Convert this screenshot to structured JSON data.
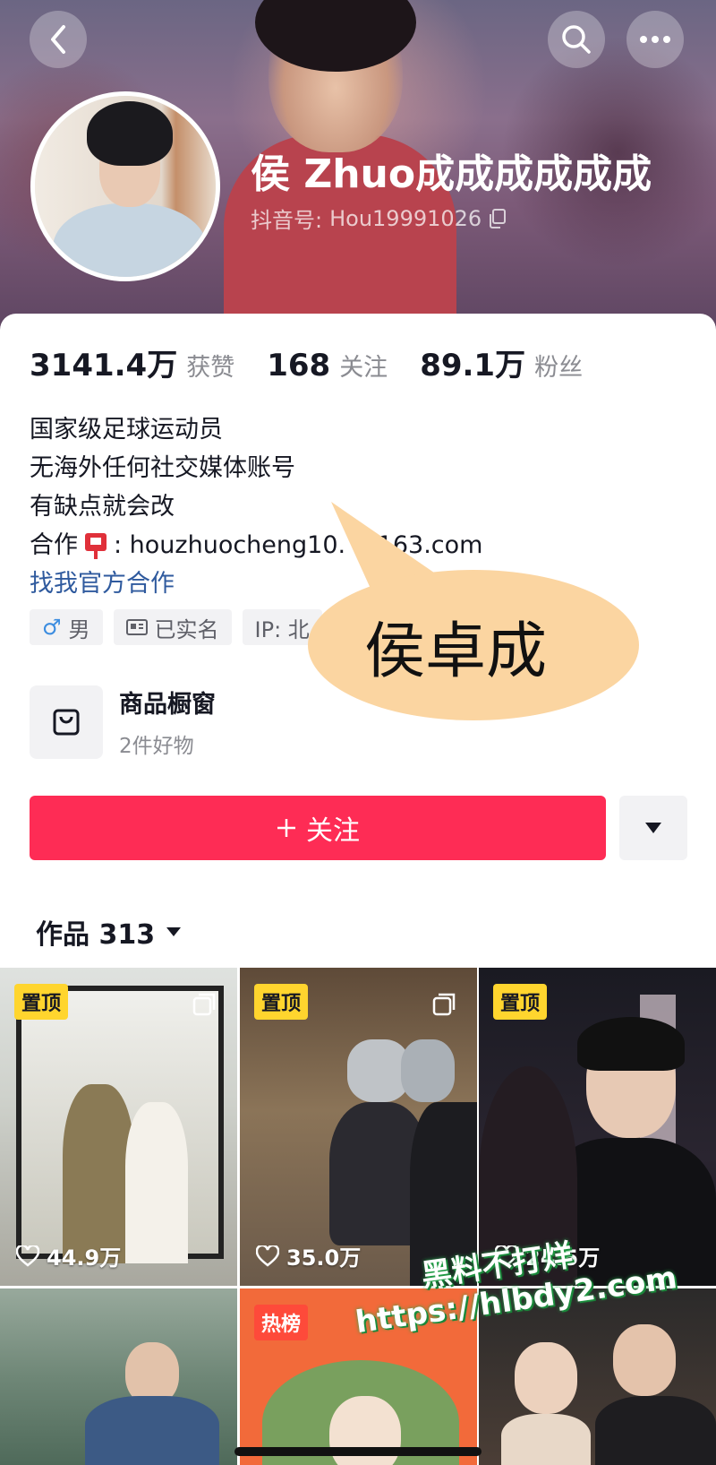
{
  "profile": {
    "name": "侯 Zhuo成成成成成成",
    "douyin_id_label": "抖音号:",
    "douyin_id": "Hou19991026"
  },
  "stats": [
    {
      "value": "3141.4万",
      "label": "获赞"
    },
    {
      "value": "168",
      "label": "关注"
    },
    {
      "value": "89.1万",
      "label": "粉丝"
    }
  ],
  "bio": {
    "line1": "国家级足球运动员",
    "line2": "无海外任何社交媒体账号",
    "line3": "有缺点就会改",
    "coop_label": "合作",
    "coop_email": ": houzhuocheng10.  @163.com",
    "official_link": "找我官方合作"
  },
  "tags": {
    "gender": "男",
    "verified": "已实名",
    "ip": "IP: 北"
  },
  "shop": {
    "title": "商品橱窗",
    "subtitle": "2件好物"
  },
  "actions": {
    "follow_label": "关注"
  },
  "works": {
    "label": "作品 313"
  },
  "annotation": {
    "bubble_text": "侯卓成"
  },
  "videos": [
    {
      "badge": "置顶",
      "likes": "44.9万"
    },
    {
      "badge": "置顶",
      "likes": "35.0万"
    },
    {
      "badge": "置顶",
      "likes": "24.5万"
    },
    {
      "badge": "",
      "likes": ""
    },
    {
      "badge": "热榜",
      "likes": ""
    },
    {
      "badge": "",
      "likes": ""
    }
  ],
  "watermark": {
    "line1": "黑料不打烊",
    "line2": "https://hlbdy2.com"
  },
  "colors": {
    "follow": "#fe2c55",
    "link": "#2f5a9e",
    "pin_badge": "#ffd52e"
  }
}
